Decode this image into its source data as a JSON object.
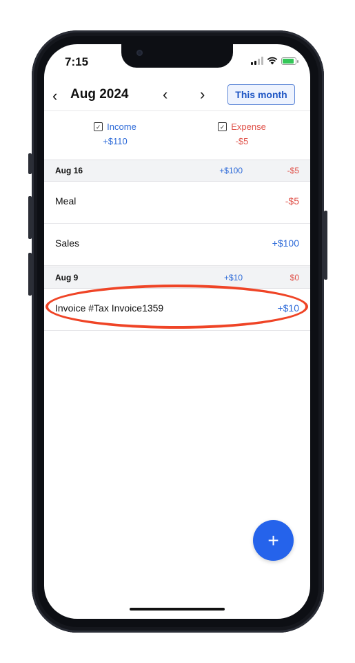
{
  "status_bar": {
    "time": "7:15"
  },
  "header": {
    "back_icon": "chevron-left",
    "month_label": "Aug 2024",
    "prev_icon": "chevron-left",
    "next_icon": "chevron-right",
    "this_month_label": "This month"
  },
  "summary": {
    "income": {
      "label": "Income",
      "amount": "+$110",
      "checked": true,
      "color": "#2d6ad8"
    },
    "expense": {
      "label": "Expense",
      "amount": "-$5",
      "checked": true,
      "color": "#e0524a"
    }
  },
  "groups": [
    {
      "date": "Aug 16",
      "income": "+$100",
      "expense": "-$5",
      "items": [
        {
          "name": "Meal",
          "amount": "-$5",
          "type": "expense"
        },
        {
          "name": "Sales",
          "amount": "+$100",
          "type": "income"
        }
      ]
    },
    {
      "date": "Aug 9",
      "income": "+$10",
      "expense": "$0",
      "items": [
        {
          "name": "Invoice #Tax Invoice1359",
          "amount": "+$10",
          "type": "income"
        }
      ]
    }
  ],
  "fab": {
    "label": "+"
  },
  "colors": {
    "accent": "#2563eb",
    "income": "#2d6ad8",
    "expense": "#e0524a",
    "highlight": "#ef4426"
  }
}
